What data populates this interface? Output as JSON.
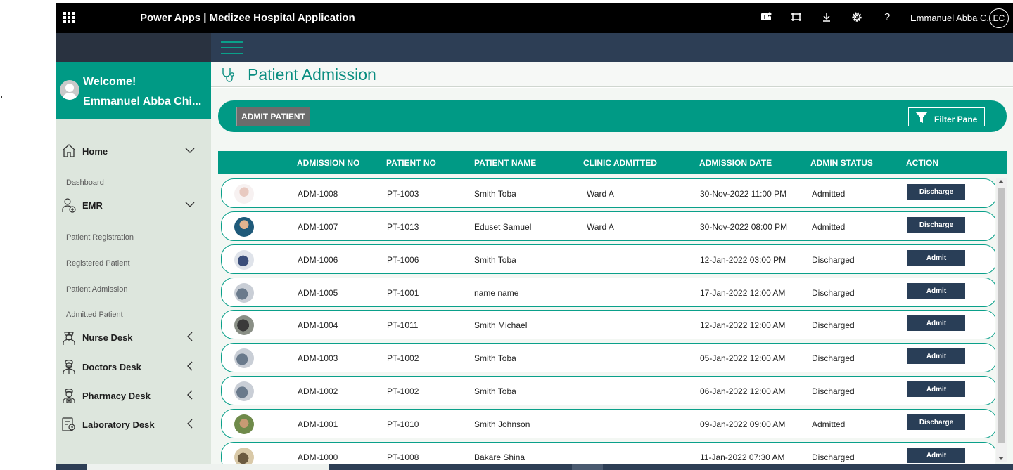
{
  "topbar": {
    "title": "Power Apps  |  Medizee Hospital Application",
    "user_name": "Emmanuel Abba C...",
    "user_initials": "EC",
    "icons": [
      "teams-icon",
      "focus-icon",
      "download-icon",
      "settings-icon",
      "help-icon"
    ]
  },
  "sidebar": {
    "welcome": "Welcome!",
    "user_full": "Emmanuel Abba Chi...",
    "home": "Home",
    "dashboard": "Dashboard",
    "emr": "EMR",
    "emr_items": [
      "Patient Registration",
      "Registered Patient",
      "Patient Admission",
      "Admitted Patient"
    ],
    "nurse_desk": "Nurse Desk",
    "doctors_desk": "Doctors Desk",
    "pharmacy_desk": "Pharmacy Desk",
    "laboratory_desk": "Laboratory Desk"
  },
  "page": {
    "title": "Patient Admission",
    "admit_button": "ADMIT PATIENT",
    "filter_button": "Filter Pane"
  },
  "table": {
    "headers": [
      "ADMISSION NO",
      "PATIENT NO",
      "PATIENT NAME",
      "CLINIC ADMITTED",
      "ADMISSION DATE",
      "ADMIN STATUS",
      "ACTION"
    ],
    "rows": [
      {
        "admission_no": "ADM-1008",
        "patient_no": "PT-1003",
        "patient_name": "Smith Toba",
        "clinic": "Ward A",
        "date": "30-Nov-2022 11:00 PM",
        "status": "Admitted",
        "action": "Discharge"
      },
      {
        "admission_no": "ADM-1007",
        "patient_no": "PT-1013",
        "patient_name": "Eduset Samuel",
        "clinic": "Ward A",
        "date": "30-Nov-2022 08:00 PM",
        "status": "Admitted",
        "action": "Discharge"
      },
      {
        "admission_no": "ADM-1006",
        "patient_no": "PT-1006",
        "patient_name": "Smith Toba",
        "clinic": "",
        "date": "12-Jan-2022 03:00 PM",
        "status": "Discharged",
        "action": "Admit"
      },
      {
        "admission_no": "ADM-1005",
        "patient_no": "PT-1001",
        "patient_name": "name name",
        "clinic": "",
        "date": "17-Jan-2022 12:00 AM",
        "status": "Discharged",
        "action": "Admit"
      },
      {
        "admission_no": "ADM-1004",
        "patient_no": "PT-1011",
        "patient_name": "Smith Michael",
        "clinic": "",
        "date": "12-Jan-2022 12:00 AM",
        "status": "Discharged",
        "action": "Admit"
      },
      {
        "admission_no": "ADM-1003",
        "patient_no": "PT-1002",
        "patient_name": "Smith Toba",
        "clinic": "",
        "date": "05-Jan-2022 12:00 AM",
        "status": "Discharged",
        "action": "Admit"
      },
      {
        "admission_no": "ADM-1002",
        "patient_no": "PT-1002",
        "patient_name": "Smith Toba",
        "clinic": "",
        "date": "06-Jan-2022 12:00 AM",
        "status": "Discharged",
        "action": "Admit"
      },
      {
        "admission_no": "ADM-1001",
        "patient_no": "PT-1010",
        "patient_name": "Smith Johnson",
        "clinic": "",
        "date": "09-Jan-2022 09:00 AM",
        "status": "Admitted",
        "action": "Discharge"
      },
      {
        "admission_no": "ADM-1000",
        "patient_no": "PT-1008",
        "patient_name": "Bakare Shina",
        "clinic": "",
        "date": "11-Jan-2022 07:30 AM",
        "status": "Discharged",
        "action": "Admit"
      }
    ]
  },
  "colors": {
    "teal": "#009a85",
    "navy": "#2d3e55",
    "action_button": "#293e57",
    "sidebar_bg": "#dde6dd"
  }
}
